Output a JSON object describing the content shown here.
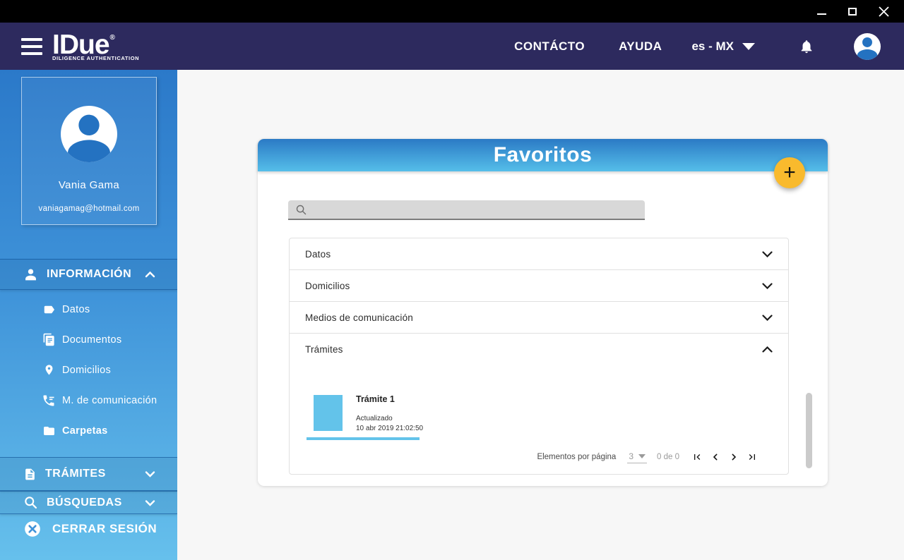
{
  "window": {
    "controls": [
      "minimize-icon",
      "maximize-icon",
      "close-icon"
    ]
  },
  "header": {
    "logo": {
      "name": "IDue",
      "registered": "®",
      "tagline": "DILIGENCE AUTHENTICATION"
    },
    "nav": {
      "contact": "CONTÁCTO",
      "help": "AYUDA"
    },
    "language": {
      "value": "es - MX"
    },
    "icons": [
      "hamburger-icon",
      "bell-icon",
      "avatar"
    ]
  },
  "sidebar": {
    "profile": {
      "name": "Vania Gama",
      "email": "vaniagamag@hotmail.com"
    },
    "sections": [
      {
        "label": "INFORMACIÓN",
        "icon": "person-icon",
        "expanded": true,
        "items": [
          {
            "label": "Datos",
            "icon": "label-icon"
          },
          {
            "label": "Documentos",
            "icon": "documents-icon"
          },
          {
            "label": "Domicilios",
            "icon": "location-pin-icon"
          },
          {
            "label": "M. de comunicación",
            "icon": "phone-icon"
          },
          {
            "label": "Carpetas",
            "icon": "folder-icon"
          }
        ]
      },
      {
        "label": "TRÁMITES",
        "icon": "document-icon",
        "expanded": false
      },
      {
        "label": "BÚSQUEDAS",
        "icon": "search-icon",
        "expanded": false
      }
    ],
    "logout": {
      "label": "CERRAR SESIÓN",
      "icon": "cancel-circle-icon"
    }
  },
  "main": {
    "card": {
      "title": "Favoritos",
      "fab_label": "+",
      "search": {
        "value": "",
        "icon": "search-icon"
      },
      "accordion": [
        {
          "label": "Datos",
          "expanded": false
        },
        {
          "label": "Domicilios",
          "expanded": false
        },
        {
          "label": "Medios de comunicación",
          "expanded": false
        },
        {
          "label": "Trámites",
          "expanded": true
        }
      ],
      "tramite": {
        "title": "Trámite 1",
        "status": "Actualizado",
        "timestamp": "10 abr 2019 21:02:50"
      },
      "pagination": {
        "label": "Elementos por página",
        "page_size": "3",
        "range": "0 de 0",
        "icons": [
          "first-page-icon",
          "prev-page-icon",
          "next-page-icon",
          "last-page-icon"
        ]
      }
    }
  },
  "colors": {
    "titlebar": "#000000",
    "appbar": "#2d2a5e",
    "sidebar_top": "#2b79c9",
    "sidebar_bottom": "#66c0ec",
    "card_header_top": "#2b7ac5",
    "card_header_bottom": "#55bee9",
    "fab": "#f9ba2d",
    "tile_blue": "#63c3ea",
    "main_bg": "#f7f7f7"
  }
}
